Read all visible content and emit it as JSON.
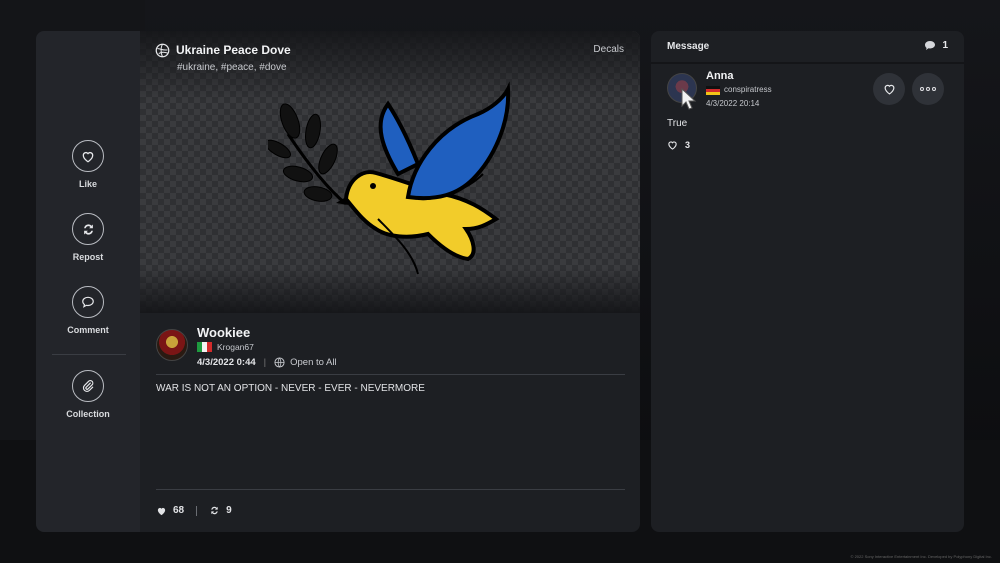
{
  "actions": [
    {
      "label": "Like",
      "icon": "heart-icon"
    },
    {
      "label": "Repost",
      "icon": "repost-icon"
    },
    {
      "label": "Comment",
      "icon": "comment-icon"
    },
    {
      "label": "Collection",
      "icon": "paperclip-icon"
    }
  ],
  "post": {
    "title": "Ukraine Peace Dove",
    "tags": "#ukraine, #peace, #dove",
    "category": "Decals",
    "author": {
      "name": "Wookiee",
      "handle": "Krogan67",
      "flag": "italy-flag",
      "date": "4/3/2022 0:44",
      "visibility": "Open to All"
    },
    "text": "WAR IS NOT AN OPTION - NEVER - EVER - NEVERMORE",
    "likes": "68",
    "reposts": "9"
  },
  "messages": {
    "header": "Message",
    "count": "1",
    "items": [
      {
        "name": "Anna",
        "handle": "conspiratress",
        "flag": "germany-flag",
        "date": "4/3/2022 20:14",
        "text": "True",
        "likes": "3"
      }
    ]
  },
  "footnote": "© 2022 Sony Interactive Entertainment Inc. Developed by Polyphony Digital Inc.",
  "colors": {
    "dove_blue": "#1f5fbf",
    "dove_yellow": "#f2cc2a",
    "panel": "#1d1f23",
    "rail": "#23252a"
  }
}
